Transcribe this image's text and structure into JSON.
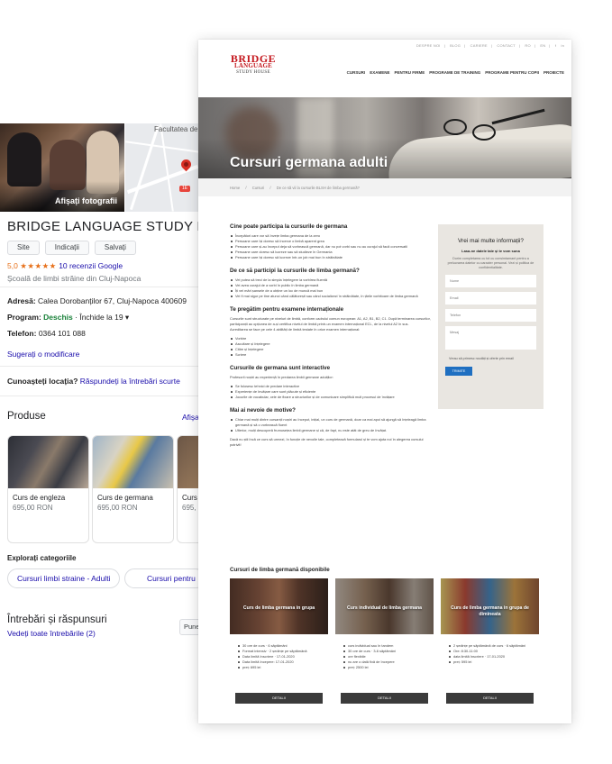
{
  "google": {
    "photos_label": "Afișați fotografii",
    "map_label": "Facultatea de",
    "map_badge": "1E",
    "title": "BRIDGE LANGUAGE STUDY H",
    "buttons": [
      "Site",
      "Indicații",
      "Salvați"
    ],
    "rating_value": "5,0",
    "stars": "★★★★★",
    "reviews": "10 recenzii Google",
    "category": "Școală de limbi străine din Cluj-Napoca",
    "address_label": "Adresă:",
    "address": "Calea Dorobanților 67, Cluj-Napoca 400609",
    "program_label": "Program:",
    "program_status": "Deschis",
    "program_close": "· Închide la 19 ▾",
    "phone_label": "Telefon:",
    "phone": "0364 101 088",
    "suggest_edit": "Sugerați o modificare",
    "know_q": "Cunoașteți locația?",
    "know_link": "Răspundeți la întrebări scurte",
    "products_title": "Produse",
    "products_all": "Afișa",
    "products": [
      {
        "name": "Curs de engleza",
        "price": "695,00 RON"
      },
      {
        "name": "Curs de germana",
        "price": "695,00 RON"
      },
      {
        "name": "Curs de",
        "price": "695,"
      }
    ],
    "explore_title": "Explorați categoriile",
    "chips": [
      "Cursuri limbi straine - Adulti",
      "Cursuri pentru"
    ],
    "qa_title": "Întrebări și răspunsuri",
    "qa_link": "Vedeți toate întrebările (2)",
    "qa_button": "Pune"
  },
  "site": {
    "topnav": [
      "DESPRE NOI",
      "|",
      "BLOG",
      "|",
      "CARIERE",
      "|",
      "CONTACT",
      "|",
      "RO",
      "|",
      "EN",
      "|",
      "f",
      "in"
    ],
    "logo": {
      "line1": "BRIDGE",
      "line2": "LANGUAGE",
      "line3": "STUDY HOUSE"
    },
    "mainnav": [
      "CURSURI",
      "EXAMENE",
      "PENTRU FIRME",
      "PROGRAME DE TRAINING",
      "PROGRAME PENTRU COPII",
      "PROIECTE"
    ],
    "hero_title": "Cursuri germana adulti",
    "breadcrumbs": [
      "Home",
      "/",
      "Cursuri",
      "/",
      "De ce să vii la cursurile BLSH de limba germană?"
    ],
    "s1": {
      "title": "Cine poate participa la cursurile de germana",
      "items": [
        "Începători care vor să învețe limba germana de la zero",
        "Persoane care își doresc să încerce o limbă aparent grea",
        "Persoane care și-au început deja să vorbească germană, dar nu pot vorbi sau nu au curajul să facă conversatii",
        "Persoane care doresc să lucreze sau să studieze în Germania",
        "Persoane care își doresc să lucreze într-un job mai bun în străinătate"
      ]
    },
    "s2": {
      "title": "De ce să participi la cursurile de limba germană?",
      "items": [
        "Vei putea să treci de la simpla înțelegere la vorbirea fluentă",
        "Vei avea curajul de a vorbi în public în limba germană",
        "Îți vei mări șansele de a obține un loc de muncă mai bun",
        "Vei fi mai sigur pe tine atunci când călătorești sau când socializezi în străinătate, în țările vorbitoare de limba germană"
      ]
    },
    "s3": {
      "title": "Te pregătim pentru examene internaționale",
      "para1": "Cursurile sunt structurate pe niveluri de limbă, conform cadrului comun european: A1, A2, B1, B2, C1. După terminarea cursurilor, participanții au opțiunea de a-și certifica nivelul de limbă printr-un examen internațional ECL, de la nivelul A2 în sus.",
      "para2": "Acreditarea se face pe cele 4 abilități de limbă testate în orice examen internațional:",
      "items": [
        "Vorbire",
        "Ascultare și înțelegere",
        "Citire și înțelegere",
        "Scriere"
      ]
    },
    "s4": {
      "title": "Cursurile de germana sunt interactive",
      "para": "Profesorii noștri au experiență în predarea limbii germane adulților:",
      "items": [
        "Se folosesc tehnici de predare interactive",
        "Experiențe de învățare care sunt plăcute și eficiente",
        "Jocurile de vocabular, cele de fixare a structurilor și de comunicare simplifică mult procesul de învățare"
      ]
    },
    "s5": {
      "title": "Mai ai nevoie de motive?",
      "items": [
        "Chiar mai mulți dintre cursanții noștri au început, inițial, un curs de germană, doar ca mai apoi să ajungă să înțeleagă limba germană și să o vorbească fluent",
        "Ulterior, mulți descoperă frumusețea limbii germane și că, de fapt, nu este atât de greu de învățat."
      ],
      "para": "Dacă nu știi încă ce curs să urmezi, în funcție de nevoile tale, completează formularul și te vom ajuta noi în alegerea cursului potrivit!"
    },
    "form": {
      "title": "Vrei mai multe informații?",
      "subtitle": "Lasa-ne datele tale și te vom suna",
      "text": "Dorim completarea cu tot cu consimtamant pentru a prelucrarea datelor cu caracter personal. Vezi și politica de confidentialitate.",
      "name": "Nume",
      "email": "Email",
      "phone": "Telefon",
      "message": "Mesaj",
      "checkbox": "Vreau să primesc noutăți și oferte prin email",
      "submit": "TRIMITE"
    },
    "courses_title": "Cursuri de limba germană disponibile",
    "cards": [
      {
        "title": "Curs de limba germana in grupa",
        "items": [
          "30 ore de curs · 6 săptămâni",
          "Format intensiv · 2 ședințe pe săptămână",
          "Data limită înscriere · 17-01-2020",
          "Data limită începere: 17-01-2020",
          "preț: 695 lei"
        ],
        "button": "DETALII"
      },
      {
        "title": "Curs individual de limba germana",
        "items": [
          "curs individual sau în tandem",
          "30 ore de curs · 3-6 săptămâni",
          "ore flexibile",
          "nu are o dată fixă de începere",
          "preț: 2500 lei"
        ],
        "button": "DETALII"
      },
      {
        "title": "Curs de limba germana in grupa de dimineata",
        "items": [
          "2 ședințe pe săptămână de curs · 6 săptămâni",
          "Ore: 8:30-11:00",
          "data limită înscriere · 17-01-2020",
          "preț: 595 lei"
        ],
        "button": "DETALII"
      }
    ]
  }
}
